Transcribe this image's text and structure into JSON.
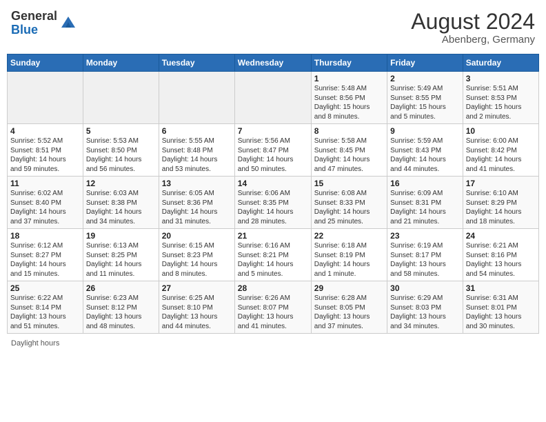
{
  "header": {
    "logo_general": "General",
    "logo_blue": "Blue",
    "month_year": "August 2024",
    "location": "Abenberg, Germany"
  },
  "weekdays": [
    "Sunday",
    "Monday",
    "Tuesday",
    "Wednesday",
    "Thursday",
    "Friday",
    "Saturday"
  ],
  "footer": {
    "daylight_note": "Daylight hours"
  },
  "weeks": [
    [
      {
        "day": "",
        "info": ""
      },
      {
        "day": "",
        "info": ""
      },
      {
        "day": "",
        "info": ""
      },
      {
        "day": "",
        "info": ""
      },
      {
        "day": "1",
        "info": "Sunrise: 5:48 AM\nSunset: 8:56 PM\nDaylight: 15 hours\nand 8 minutes."
      },
      {
        "day": "2",
        "info": "Sunrise: 5:49 AM\nSunset: 8:55 PM\nDaylight: 15 hours\nand 5 minutes."
      },
      {
        "day": "3",
        "info": "Sunrise: 5:51 AM\nSunset: 8:53 PM\nDaylight: 15 hours\nand 2 minutes."
      }
    ],
    [
      {
        "day": "4",
        "info": "Sunrise: 5:52 AM\nSunset: 8:51 PM\nDaylight: 14 hours\nand 59 minutes."
      },
      {
        "day": "5",
        "info": "Sunrise: 5:53 AM\nSunset: 8:50 PM\nDaylight: 14 hours\nand 56 minutes."
      },
      {
        "day": "6",
        "info": "Sunrise: 5:55 AM\nSunset: 8:48 PM\nDaylight: 14 hours\nand 53 minutes."
      },
      {
        "day": "7",
        "info": "Sunrise: 5:56 AM\nSunset: 8:47 PM\nDaylight: 14 hours\nand 50 minutes."
      },
      {
        "day": "8",
        "info": "Sunrise: 5:58 AM\nSunset: 8:45 PM\nDaylight: 14 hours\nand 47 minutes."
      },
      {
        "day": "9",
        "info": "Sunrise: 5:59 AM\nSunset: 8:43 PM\nDaylight: 14 hours\nand 44 minutes."
      },
      {
        "day": "10",
        "info": "Sunrise: 6:00 AM\nSunset: 8:42 PM\nDaylight: 14 hours\nand 41 minutes."
      }
    ],
    [
      {
        "day": "11",
        "info": "Sunrise: 6:02 AM\nSunset: 8:40 PM\nDaylight: 14 hours\nand 37 minutes."
      },
      {
        "day": "12",
        "info": "Sunrise: 6:03 AM\nSunset: 8:38 PM\nDaylight: 14 hours\nand 34 minutes."
      },
      {
        "day": "13",
        "info": "Sunrise: 6:05 AM\nSunset: 8:36 PM\nDaylight: 14 hours\nand 31 minutes."
      },
      {
        "day": "14",
        "info": "Sunrise: 6:06 AM\nSunset: 8:35 PM\nDaylight: 14 hours\nand 28 minutes."
      },
      {
        "day": "15",
        "info": "Sunrise: 6:08 AM\nSunset: 8:33 PM\nDaylight: 14 hours\nand 25 minutes."
      },
      {
        "day": "16",
        "info": "Sunrise: 6:09 AM\nSunset: 8:31 PM\nDaylight: 14 hours\nand 21 minutes."
      },
      {
        "day": "17",
        "info": "Sunrise: 6:10 AM\nSunset: 8:29 PM\nDaylight: 14 hours\nand 18 minutes."
      }
    ],
    [
      {
        "day": "18",
        "info": "Sunrise: 6:12 AM\nSunset: 8:27 PM\nDaylight: 14 hours\nand 15 minutes."
      },
      {
        "day": "19",
        "info": "Sunrise: 6:13 AM\nSunset: 8:25 PM\nDaylight: 14 hours\nand 11 minutes."
      },
      {
        "day": "20",
        "info": "Sunrise: 6:15 AM\nSunset: 8:23 PM\nDaylight: 14 hours\nand 8 minutes."
      },
      {
        "day": "21",
        "info": "Sunrise: 6:16 AM\nSunset: 8:21 PM\nDaylight: 14 hours\nand 5 minutes."
      },
      {
        "day": "22",
        "info": "Sunrise: 6:18 AM\nSunset: 8:19 PM\nDaylight: 14 hours\nand 1 minute."
      },
      {
        "day": "23",
        "info": "Sunrise: 6:19 AM\nSunset: 8:17 PM\nDaylight: 13 hours\nand 58 minutes."
      },
      {
        "day": "24",
        "info": "Sunrise: 6:21 AM\nSunset: 8:16 PM\nDaylight: 13 hours\nand 54 minutes."
      }
    ],
    [
      {
        "day": "25",
        "info": "Sunrise: 6:22 AM\nSunset: 8:14 PM\nDaylight: 13 hours\nand 51 minutes."
      },
      {
        "day": "26",
        "info": "Sunrise: 6:23 AM\nSunset: 8:12 PM\nDaylight: 13 hours\nand 48 minutes."
      },
      {
        "day": "27",
        "info": "Sunrise: 6:25 AM\nSunset: 8:10 PM\nDaylight: 13 hours\nand 44 minutes."
      },
      {
        "day": "28",
        "info": "Sunrise: 6:26 AM\nSunset: 8:07 PM\nDaylight: 13 hours\nand 41 minutes."
      },
      {
        "day": "29",
        "info": "Sunrise: 6:28 AM\nSunset: 8:05 PM\nDaylight: 13 hours\nand 37 minutes."
      },
      {
        "day": "30",
        "info": "Sunrise: 6:29 AM\nSunset: 8:03 PM\nDaylight: 13 hours\nand 34 minutes."
      },
      {
        "day": "31",
        "info": "Sunrise: 6:31 AM\nSunset: 8:01 PM\nDaylight: 13 hours\nand 30 minutes."
      }
    ]
  ]
}
